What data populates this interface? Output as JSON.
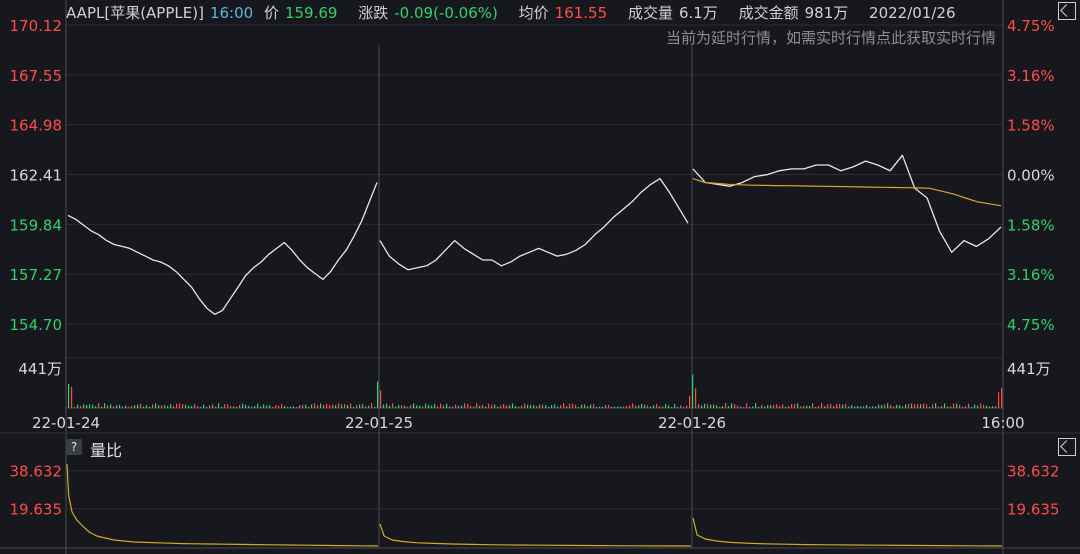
{
  "header": {
    "symbol": "AAPL[苹果(APPLE)]",
    "time": "16:00",
    "price_label": "价",
    "price": "159.69",
    "change_label": "涨跌",
    "change": "-0.09(-0.06%)",
    "avg_label": "均价",
    "avg": "161.55",
    "vol_label": "成交量",
    "vol": "6.1万",
    "amount_label": "成交金额",
    "amount": "981万",
    "date": "2022/01/26",
    "notice": "当前为延时行情，如需实时行情点此获取实时行情"
  },
  "sub_panel": {
    "help": "?",
    "title": "量比"
  },
  "colors": {
    "up": "#ff4a4a",
    "down": "#2fd16b",
    "price_line": "#e8e8e8",
    "avg_line": "#d4a92a",
    "grid": "#2a2d33",
    "divider": "#4a4d55",
    "bg": "#16181d"
  },
  "chart_data": [
    {
      "type": "line",
      "x_labels": [
        "22-01-24",
        "22-01-25",
        "22-01-26",
        "16:00"
      ],
      "y_ticks_left": [
        "170.12",
        "167.55",
        "164.98",
        "162.41",
        "159.84",
        "157.27",
        "154.70"
      ],
      "y_ticks_right": [
        "4.75%",
        "3.16%",
        "1.58%",
        "0.00%",
        "1.58%",
        "3.16%",
        "4.75%"
      ],
      "ylim": [
        154.7,
        170.12
      ],
      "reference_price": 162.41,
      "volume_tick": "441万",
      "series": [
        {
          "values": [
            160.3,
            160.1,
            159.8,
            159.5,
            159.3,
            159.0,
            158.8,
            158.7,
            158.6,
            158.4,
            158.2,
            158.0,
            157.9,
            157.7,
            157.4,
            157.0,
            156.6,
            156.0,
            155.5,
            155.2,
            155.4,
            156.0,
            156.6,
            157.2,
            157.6,
            157.9,
            158.3,
            158.6,
            158.9,
            158.5,
            158.0,
            157.6,
            157.3,
            157.0,
            157.4,
            158.0,
            158.5,
            159.2,
            160.0,
            161.0,
            162.0,
            159.0,
            158.2,
            157.8,
            157.5,
            157.6,
            157.7,
            158.0,
            158.5,
            159.0,
            158.6,
            158.3,
            158.0,
            158.0,
            157.7,
            157.9,
            158.2,
            158.4,
            158.6,
            158.4,
            158.2,
            158.3,
            158.5,
            158.8,
            159.3,
            159.7,
            160.2,
            160.6,
            161.0,
            161.5,
            161.9,
            162.2,
            161.5,
            160.7,
            159.9,
            162.7,
            162.0,
            161.9,
            161.8,
            162.0,
            162.3,
            162.4,
            162.6,
            162.7,
            162.7,
            162.9,
            162.9,
            162.6,
            162.8,
            163.1,
            162.9,
            162.6,
            163.4,
            161.7,
            161.2,
            159.5,
            158.4,
            159.0,
            158.7,
            159.1,
            159.7
          ]
        },
        {
          "values": [
            162.2,
            162.0,
            161.95,
            161.9,
            161.88,
            161.86,
            161.85,
            161.84,
            161.83,
            161.82,
            161.81,
            161.8,
            161.79,
            161.78,
            161.77,
            161.76,
            161.75,
            161.74,
            161.73,
            161.72,
            161.7,
            161.55,
            161.4,
            161.2,
            161.0,
            160.9,
            160.8
          ]
        }
      ]
    },
    {
      "type": "line",
      "y_ticks": [
        "38.632",
        "19.635"
      ],
      "ylim": [
        0,
        44.0
      ],
      "series": [
        {
          "values": [
            42,
            26,
            18,
            14,
            11,
            8,
            6,
            5,
            4,
            3.5,
            3,
            2.8,
            2.6,
            2.4,
            2.2,
            2.1,
            2,
            1.9,
            1.8,
            1.7,
            1.6,
            1.5,
            1.4,
            1.3,
            1.2,
            1.1,
            1.0
          ]
        },
        {
          "values": [
            12,
            6,
            4,
            3.2,
            2.6,
            2.3,
            2.0,
            1.8,
            1.6,
            1.5,
            1.4,
            1.3,
            1.2,
            1.1,
            1.05,
            1.0
          ]
        },
        {
          "values": [
            15,
            6.5,
            4.5,
            3.5,
            2.8,
            2.4,
            2.1,
            1.9,
            1.7,
            1.6,
            1.5,
            1.4,
            1.3,
            1.2,
            1.1,
            1.0
          ]
        }
      ]
    }
  ]
}
